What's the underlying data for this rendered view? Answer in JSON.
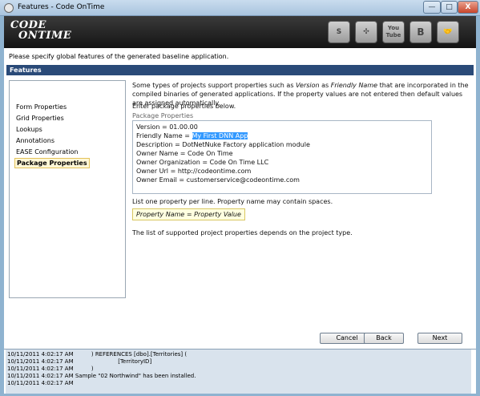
{
  "window": {
    "title": "Features - Code OnTime",
    "min_label": "—",
    "max_label": "□",
    "close_label": "X"
  },
  "header": {
    "logo_line1": "CODE",
    "logo_line2": "ONTIME",
    "social_icons": [
      "s-icon",
      "windmill-icon",
      "youtube-icon",
      "blogger-icon",
      "handshake-icon"
    ],
    "youtube_label": "You Tube",
    "blogger_label": "B"
  },
  "subtitle": "Please specify global features of the generated baseline application.",
  "section_title": "Features",
  "nav": {
    "items": [
      {
        "label": "Form Properties",
        "active": false
      },
      {
        "label": "Grid Properties",
        "active": false
      },
      {
        "label": "Lookups",
        "active": false
      },
      {
        "label": "Annotations",
        "active": false
      },
      {
        "label": "EASE Configuration",
        "active": false
      },
      {
        "label": "Package Properties",
        "active": true
      }
    ]
  },
  "content": {
    "intro_part1": "Some types of projects support properties such as ",
    "intro_italic1": "Version",
    "intro_part2": " as ",
    "intro_italic2": "Friendly Name",
    "intro_part3": " that are incorporated in the compiled binaries of generated applications. If the property values are not entered then default values are assigned automatically.",
    "enter_text": "Enter package properties below.",
    "field_label": "Package Properties",
    "lines": [
      "Version = 01.00.00",
      "Friendly Name = ",
      "Description    = DotNetNuke Factory application module",
      "Owner Name     = Code On Time",
      "Owner Organization =  Code On Time LLC",
      "Owner Url = http://codeontime.com",
      "Owner Email = customerservice@codeontime.com"
    ],
    "selected_text": "My First DNN App",
    "list_note": "List one property per line. Property name may contain spaces.",
    "property_hint": "Property Name = Property Value",
    "support_note": "The list of supported project properties depends on the project type."
  },
  "buttons": {
    "cancel": "Cancel",
    "back": "Back",
    "next": "Next"
  },
  "log": [
    "10/11/2011 4:02:17 AM          ) REFERENCES [dbo].[Territories] (",
    "10/11/2011 4:02:17 AM                         [TerritoryID]",
    "10/11/2011 4:02:17 AM          )",
    "10/11/2011 4:02:17 AM Sample \"02 Northwind\" has been installed.",
    "10/11/2011 4:02:17 AM"
  ]
}
